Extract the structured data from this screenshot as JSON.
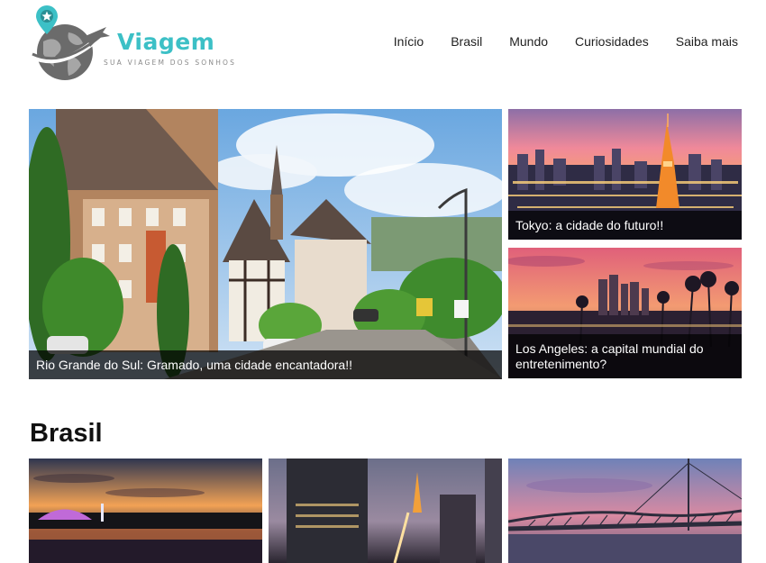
{
  "header": {
    "brand": "Viagem",
    "tagline": "SUA VIAGEM DOS SONHOS"
  },
  "nav": {
    "items": [
      {
        "label": "Início"
      },
      {
        "label": "Brasil"
      },
      {
        "label": "Mundo"
      },
      {
        "label": "Curiosidades"
      },
      {
        "label": "Saiba mais"
      }
    ]
  },
  "featured": {
    "main": {
      "caption": "Rio Grande do Sul: Gramado, uma cidade encantadora!!"
    },
    "side_top": {
      "caption": "Tokyo: a cidade do futuro!!"
    },
    "side_bottom": {
      "caption": "Los Angeles: a capital mundial do entretenimento?"
    }
  },
  "sections": {
    "brasil": {
      "title": "Brasil"
    }
  }
}
